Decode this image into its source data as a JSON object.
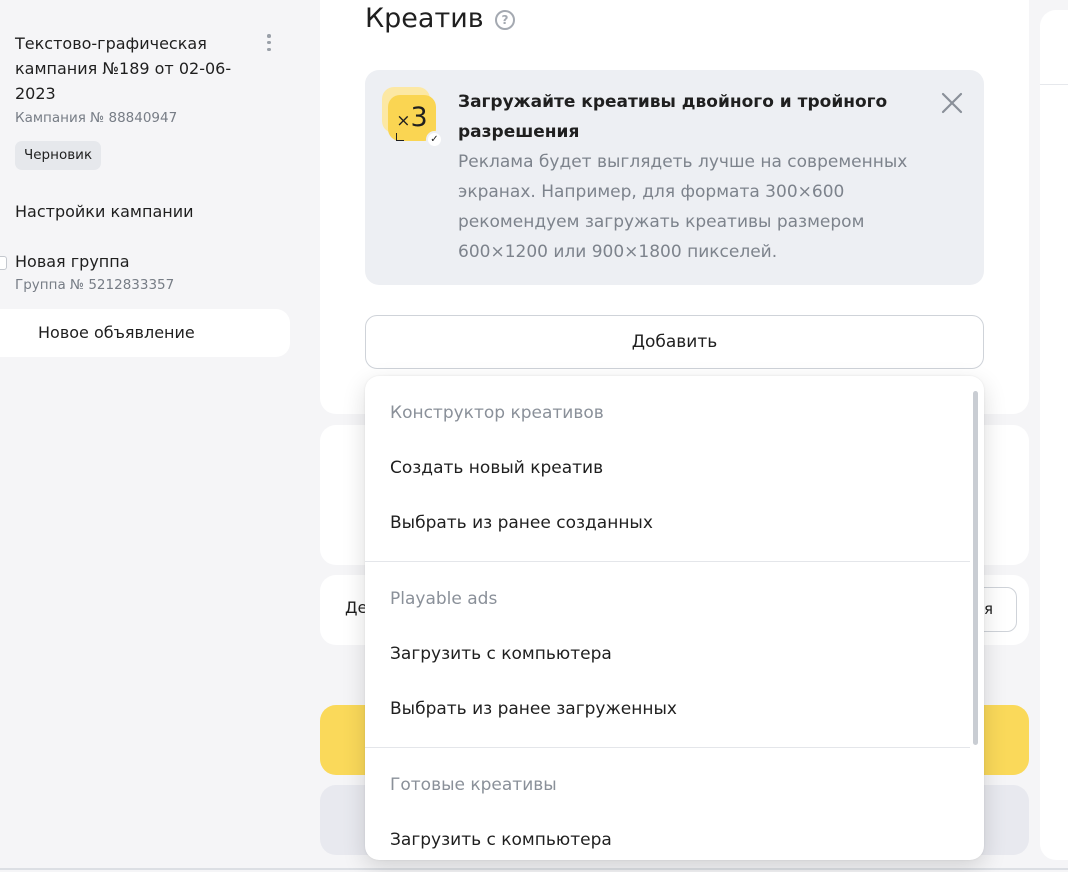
{
  "sidebar": {
    "campaign_title": "Текстово-графическая кампания №189 от 02-06-2023",
    "campaign_number": "Кампания № 88840947",
    "status": "Черновик",
    "settings_label": "Настройки кампании",
    "group_name": "Новая группа",
    "group_number": "Группа № 5212833357",
    "ad_label": "Новое объявление"
  },
  "main": {
    "title": "Креатив",
    "help_icon": "question-circle-icon",
    "tip": {
      "icon_text": "3",
      "icon_prefix": "×",
      "title": "Загружайте креативы двойного и тройного разрешения",
      "text": "Реклама будет выглядеть лучше на современных экранах. Например, для формата 300×600 рекомендуем загружать креативы размером 600×1200 или 900×1800 пикселей."
    },
    "add_button": "Добавить",
    "background_fragments": {
      "left_text": "Де",
      "right_button_text": "я"
    }
  },
  "dropdown": {
    "sections": [
      {
        "title": "Конструктор креативов",
        "items": [
          "Создать новый креатив",
          "Выбрать из ранее созданных"
        ]
      },
      {
        "title": "Playable ads",
        "items": [
          "Загрузить с компьютера",
          "Выбрать из ранее загруженных"
        ]
      },
      {
        "title": "Готовые креативы",
        "items": [
          "Загрузить с компьютера"
        ]
      }
    ]
  },
  "colors": {
    "accent_yellow": "#fad95a",
    "page_bg": "#f5f5f7",
    "tip_bg": "#edeff3",
    "muted_text": "#7d838c"
  }
}
